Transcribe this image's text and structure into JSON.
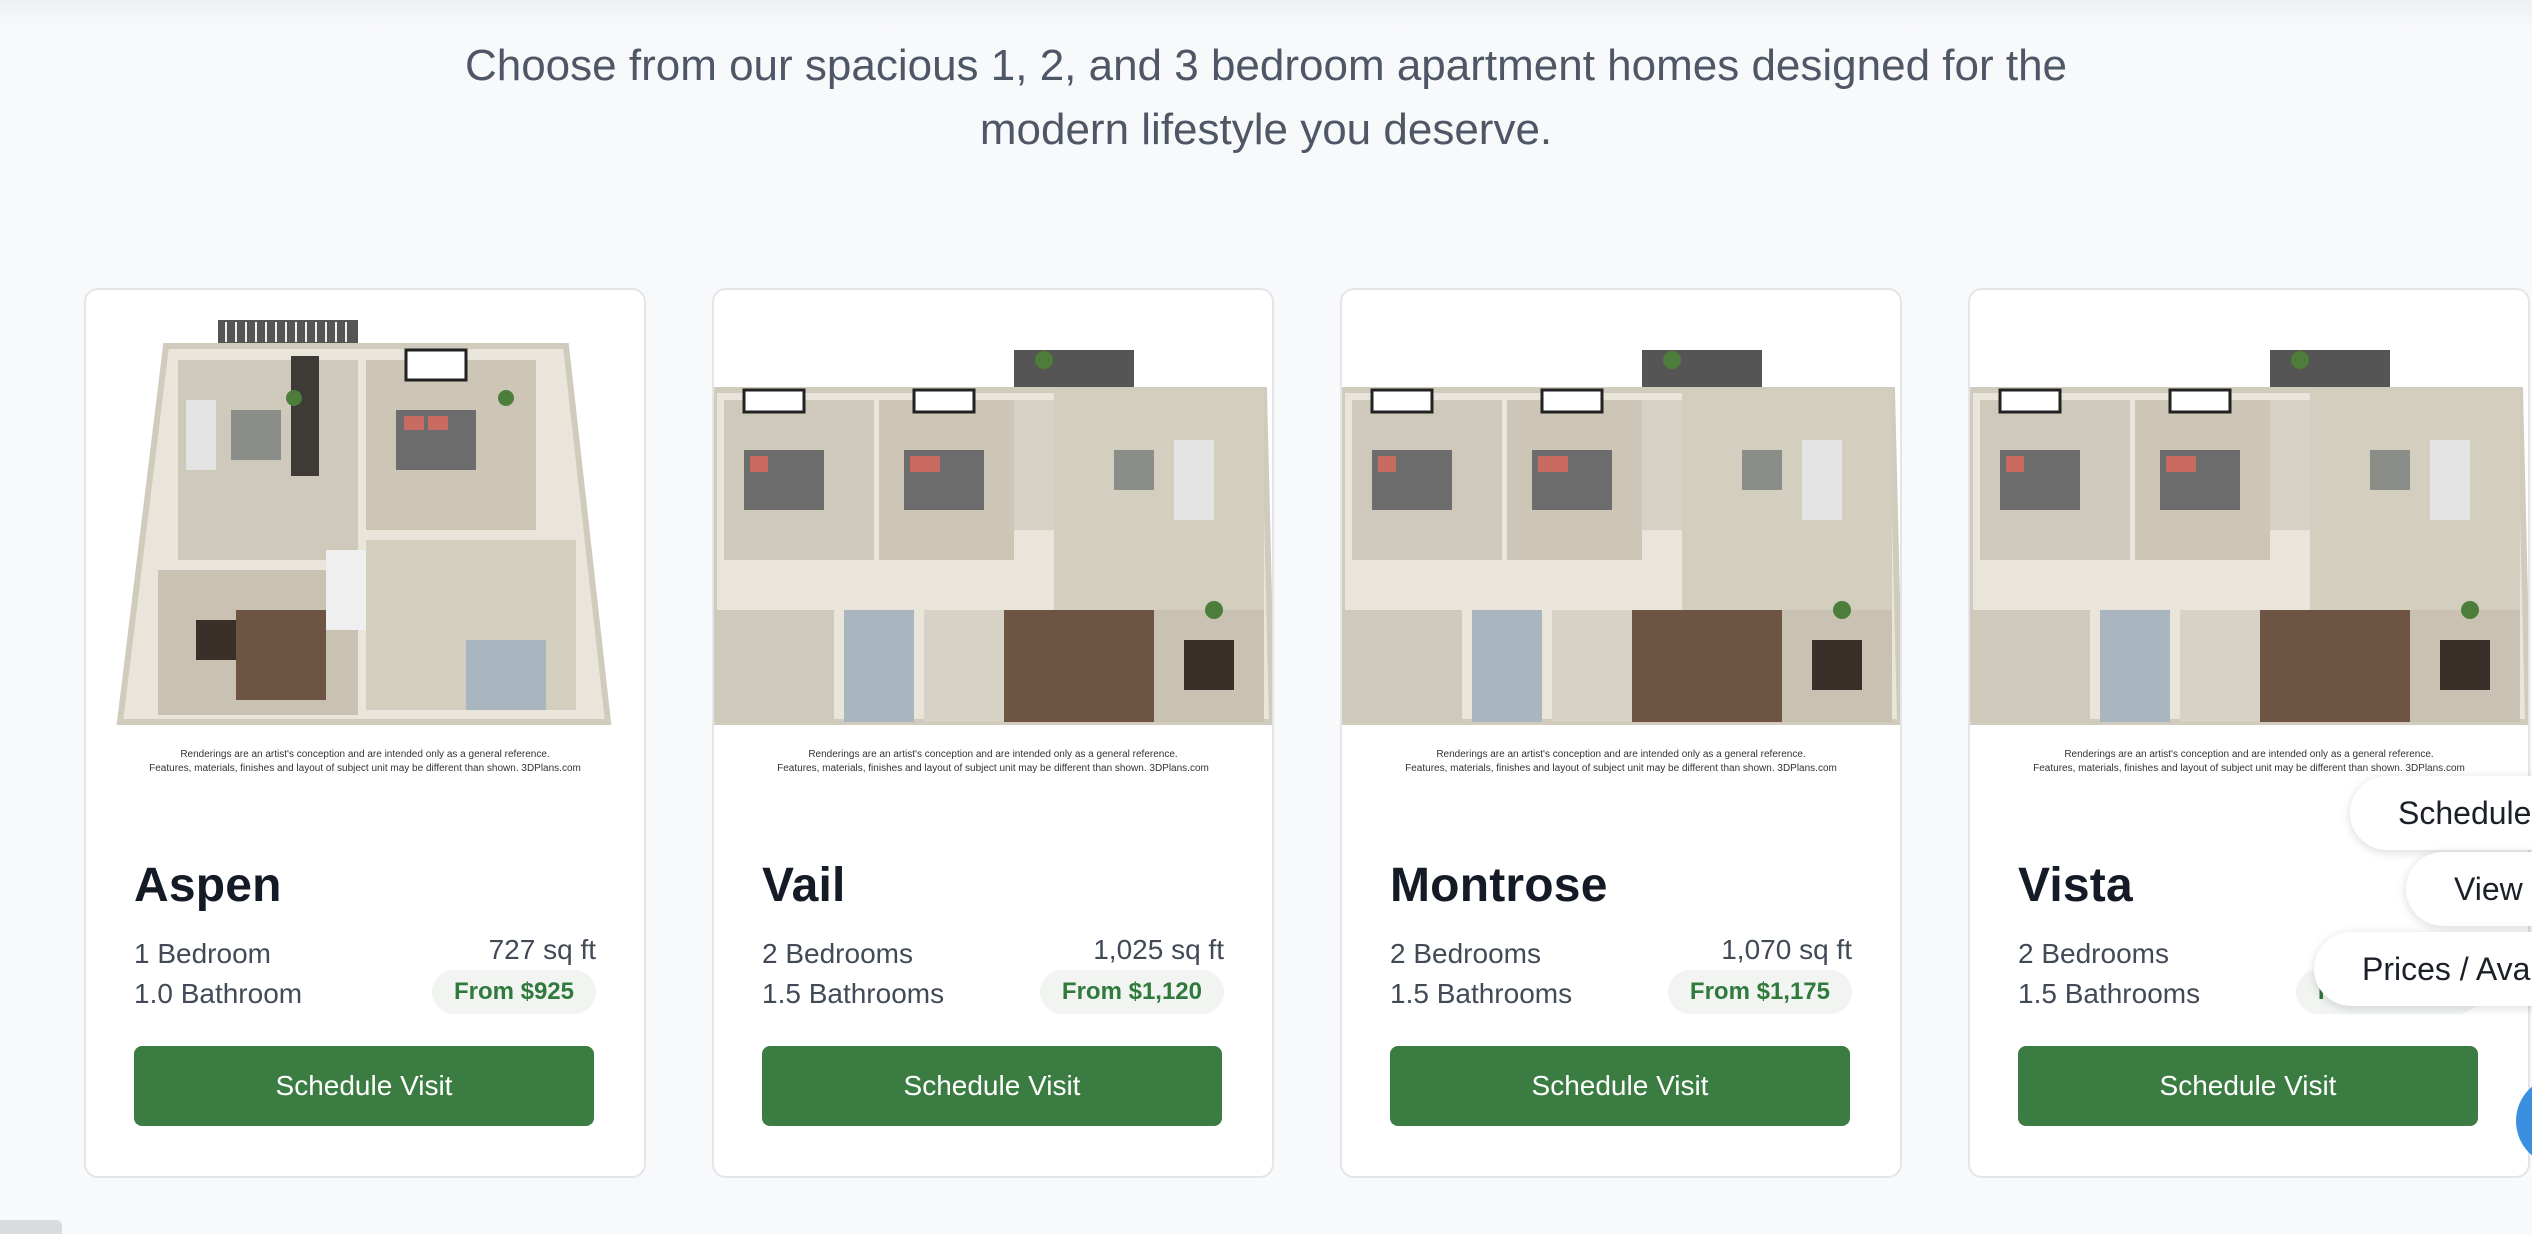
{
  "intro": {
    "line1": "Choose from our spacious 1, 2, and 3 bedroom apartment homes designed for the",
    "line2": "modern lifestyle you deserve."
  },
  "disclaimer": {
    "line1": "Renderings are an artist's conception and are intended only as a general reference.",
    "line2": "Features, materials, finishes and layout of subject unit may be different than shown. 3DPlans.com"
  },
  "floor_plans": [
    {
      "name": "Aspen",
      "beds": "1 Bedroom",
      "baths": "1.0 Bathroom",
      "sqft": "727 sq ft",
      "price": "From $925",
      "button": "Schedule Visit"
    },
    {
      "name": "Vail",
      "beds": "2 Bedrooms",
      "baths": "1.5 Bathrooms",
      "sqft": "1,025 sq ft",
      "price": "From $1,120",
      "button": "Schedule Visit"
    },
    {
      "name": "Montrose",
      "beds": "2 Bedrooms",
      "baths": "1.5 Bathrooms",
      "sqft": "1,070 sq ft",
      "price": "From $1,175",
      "button": "Schedule Visit"
    },
    {
      "name": "Vista",
      "beds": "2 Bedrooms",
      "baths": "1.5 Bathrooms",
      "sqft": "",
      "price": "From $1,175",
      "button": "Schedule Visit"
    }
  ],
  "floating_menu": {
    "schedule": "Schedule",
    "view": "View",
    "prices": "Prices / Ava"
  },
  "colors": {
    "primary_green": "#3a7c41",
    "price_text": "#2f7a3c",
    "chat_blue": "#3a8fe0"
  }
}
